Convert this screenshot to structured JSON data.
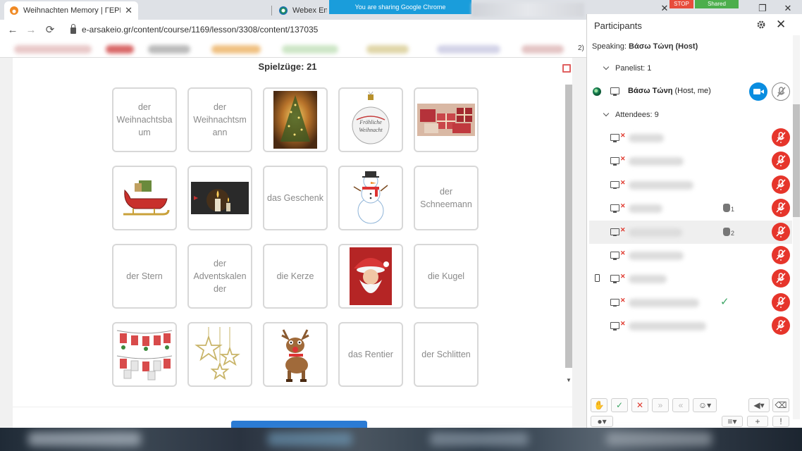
{
  "browser": {
    "tabs": [
      {
        "title": "Weihnachten Memory | ΓΕΡΜΑΝΙΚΑ",
        "active": true
      },
      {
        "title": "Webex Enterprise",
        "active": false
      }
    ],
    "tab_close": "✕",
    "sharing_banner": "You are sharing Google Chrome",
    "stop_label": "STOP",
    "shared_label": "Shared",
    "url": "e-arsakeio.gr/content/course/1169/lesson/3308/content/137035",
    "nav": {
      "back": "←",
      "forward": "→",
      "reload": "⟳"
    },
    "window": {
      "minimize": "—",
      "maximize": "❐",
      "close": "✕"
    },
    "zoom_hint": "2)"
  },
  "game": {
    "moves_label": "Spielzüge: 21",
    "cards": [
      {
        "type": "word",
        "text": "der\nWeihnachtsba\num"
      },
      {
        "type": "word",
        "text": "der\nWeihnachtsm\nann"
      },
      {
        "type": "image",
        "icon": "christmas-tree-photo"
      },
      {
        "type": "image",
        "icon": "ornament-ball",
        "caption": "Fröhliche Weihnacht"
      },
      {
        "type": "image",
        "icon": "gifts-photo"
      },
      {
        "type": "image",
        "icon": "sleigh"
      },
      {
        "type": "image",
        "icon": "advent-candles-photo"
      },
      {
        "type": "word",
        "text": "das Geschenk"
      },
      {
        "type": "image",
        "icon": "snowman"
      },
      {
        "type": "word",
        "text": "der\nSchneemann"
      },
      {
        "type": "word",
        "text": "der Stern"
      },
      {
        "type": "word",
        "text": "der\nAdventskalen\nder"
      },
      {
        "type": "word",
        "text": "die Kerze"
      },
      {
        "type": "image",
        "icon": "santa-claus-photo"
      },
      {
        "type": "word",
        "text": "die Kugel"
      },
      {
        "type": "image",
        "icon": "advent-calendar"
      },
      {
        "type": "image",
        "icon": "stars"
      },
      {
        "type": "image",
        "icon": "reindeer"
      },
      {
        "type": "word",
        "text": "das Rentier"
      },
      {
        "type": "word",
        "text": "der Schlitten"
      }
    ]
  },
  "participants": {
    "title": "Participants",
    "speaking_label": "Speaking:",
    "speaking_name": "Βάσω Τώνη (Host)",
    "panelist_label": "Panelist: 1",
    "host": {
      "name": "Βάσω Τώνη",
      "role": "(Host, me)"
    },
    "attendees_label": "Attendees: 9",
    "attendees": [
      {
        "hand": null,
        "check": false,
        "phone": false,
        "highlight": false
      },
      {
        "hand": null,
        "check": false,
        "phone": false,
        "highlight": false
      },
      {
        "hand": null,
        "check": false,
        "phone": false,
        "highlight": false
      },
      {
        "hand": "1",
        "check": false,
        "phone": false,
        "highlight": false
      },
      {
        "hand": "2",
        "check": false,
        "phone": false,
        "highlight": true
      },
      {
        "hand": null,
        "check": false,
        "phone": false,
        "highlight": false
      },
      {
        "hand": null,
        "check": false,
        "phone": true,
        "highlight": false
      },
      {
        "hand": null,
        "check": true,
        "phone": false,
        "highlight": false
      },
      {
        "hand": null,
        "check": false,
        "phone": false,
        "highlight": false
      }
    ],
    "colors": {
      "mute_red": "#e6352b",
      "video_blue": "#0a8de0",
      "check_green": "#3ca564"
    }
  }
}
